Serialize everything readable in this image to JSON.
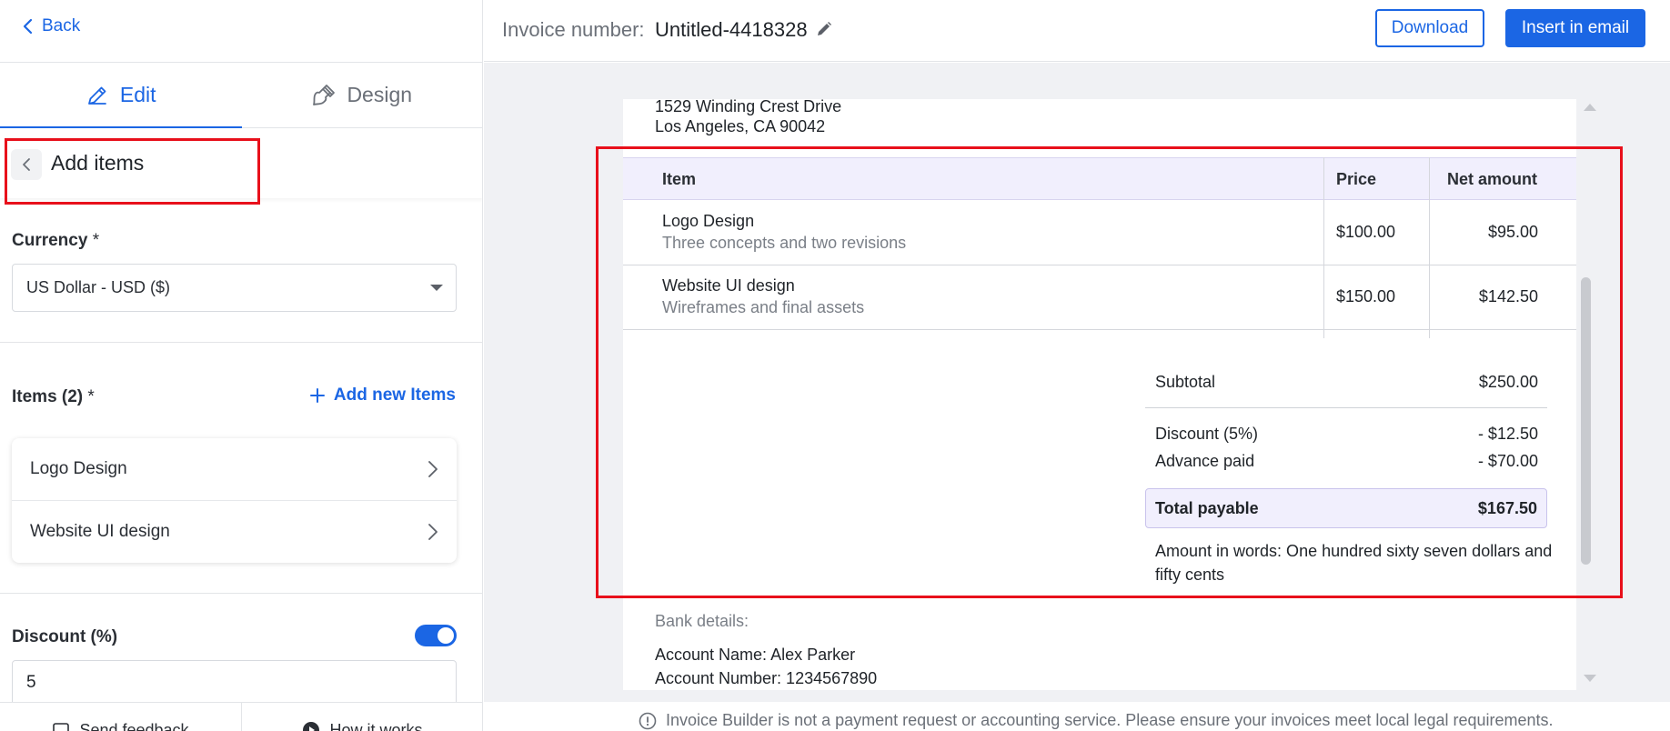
{
  "nav": {
    "back_label": "Back"
  },
  "tabs": [
    {
      "label": "Edit",
      "icon": "pencil-icon",
      "active": true
    },
    {
      "label": "Design",
      "icon": "brush-icon",
      "active": false
    }
  ],
  "add_items": {
    "title": "Add items"
  },
  "currency": {
    "label": "Currency",
    "required_mark": "*",
    "value": "US Dollar - USD ($)"
  },
  "items": {
    "label": "Items (2)",
    "required_mark": "*",
    "add_new_label": "Add new Items",
    "list": [
      "Logo Design",
      "Website UI design"
    ]
  },
  "discount": {
    "label": "Discount (%)",
    "enabled": true,
    "value": "5"
  },
  "footer": {
    "feedback_label": "Send feedback",
    "how_label": "How it works"
  },
  "header": {
    "invoice_label": "Invoice number:",
    "invoice_value": "Untitled-4418328",
    "download_label": "Download",
    "insert_label": "Insert in email",
    "accent_color": "#1b66e4"
  },
  "invoice": {
    "address": [
      "1529 Winding Crest Drive",
      "Los Angeles, CA 90042"
    ],
    "columns": [
      "Item",
      "Price",
      "Net amount"
    ],
    "rows": [
      {
        "name": "Logo Design",
        "desc": "Three concepts and two revisions",
        "price": "$100.00",
        "net": "$95.00"
      },
      {
        "name": "Website UI design",
        "desc": "Wireframes and final assets",
        "price": "$150.00",
        "net": "$142.50"
      }
    ],
    "subtotal_label": "Subtotal",
    "subtotal": "$250.00",
    "discount_label": "Discount (5%)",
    "discount": "- $12.50",
    "advance_label": "Advance paid",
    "advance": "- $70.00",
    "total_label": "Total payable",
    "total": "$167.50",
    "words": "Amount in words: One hundred sixty seven dollars and fifty cents",
    "bank_label": "Bank details:",
    "bank_name": "Account Name: Alex Parker",
    "bank_number": "Account Number: 1234567890"
  },
  "notice": "Invoice Builder is not a payment request or accounting service. Please ensure your invoices meet local legal requirements."
}
